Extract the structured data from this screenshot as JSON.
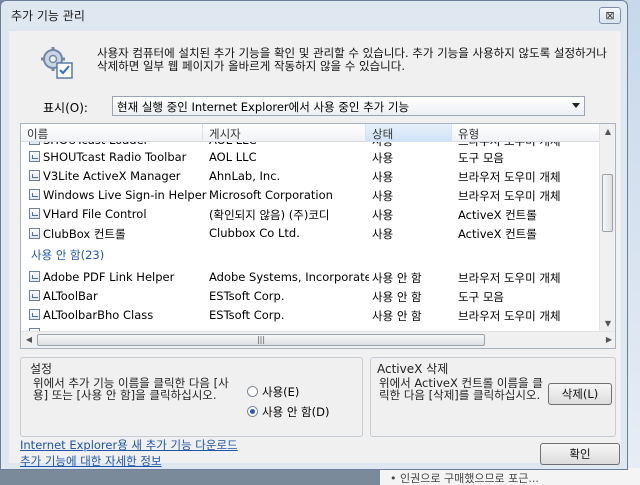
{
  "window": {
    "title": "추가 기능 관리",
    "close_label": "⊠"
  },
  "description": "사용자 컴퓨터에 설치된 추가 기능을 확인 및 관리할 수 있습니다. 추가 기능을 사용하지 않도록 설정하거나 삭제하면 일부 웹 페이지가 올바르게 작동하지 않을 수 있습니다.",
  "show": {
    "label": "표시(O):",
    "selected": "현재 실행 중인 Internet Explorer에서 사용 중인 추가 기능"
  },
  "columns": {
    "name": "이름",
    "publisher": "게시자",
    "status": "상태",
    "type": "유형"
  },
  "rows_enabled": [
    {
      "name": "SHOUTcast Radio Toolbar",
      "publisher": "AOL LLC",
      "status": "사용",
      "type": "도구 모음"
    },
    {
      "name": "V3Lite ActiveX Manager",
      "publisher": "AhnLab, Inc.",
      "status": "사용",
      "type": "브라우저 도우미 개체"
    },
    {
      "name": "Windows Live Sign-in Helper",
      "publisher": "Microsoft Corporation",
      "status": "사용",
      "type": "브라우저 도우미 개체"
    },
    {
      "name": "VHard File Control",
      "publisher": "(확인되지 않음) (주)코디",
      "status": "사용",
      "type": "ActiveX 컨트롤"
    },
    {
      "name": "ClubBox 컨트롤",
      "publisher": "Clubbox Co Ltd.",
      "status": "사용",
      "type": "ActiveX 컨트롤"
    }
  ],
  "group_disabled": {
    "label": "사용 안 함(23)"
  },
  "rows_disabled": [
    {
      "name": "Adobe PDF Link Helper",
      "publisher": "Adobe Systems, Incorporated",
      "status": "사용 안 함",
      "type": "브라우저 도우미 개체"
    },
    {
      "name": "ALToolBar",
      "publisher": "ESTsoft Corp.",
      "status": "사용 안 함",
      "type": "도구 모음"
    },
    {
      "name": "ALToolbarBho Class",
      "publisher": "ESTsoft Corp.",
      "status": "사용 안 함",
      "type": "브라우저 도우미 개체"
    }
  ],
  "settings": {
    "title": "설정",
    "text": "위에서 추가 기능 이름을 클릭한 다음 [사용] 또는 [사용 안 함]을 클릭하십시오.",
    "radio_enable": "사용(E)",
    "radio_disable": "사용 안 함(D)",
    "selected": "disable"
  },
  "activex": {
    "title": "ActiveX 삭제",
    "text": "위에서 ActiveX 컨트롤 이름을 클릭한 다음 [삭제]를 클릭하십시오.",
    "delete_label": "삭제(L)"
  },
  "links": {
    "download": "Internet Explorer용 새 추가 기능 다운로드",
    "more_info": "추가 기능에 대한 자세한 정보"
  },
  "ok_label": "확인",
  "background": {
    "bottom_text": "• 인권으로 구매했으므로 포근..."
  }
}
